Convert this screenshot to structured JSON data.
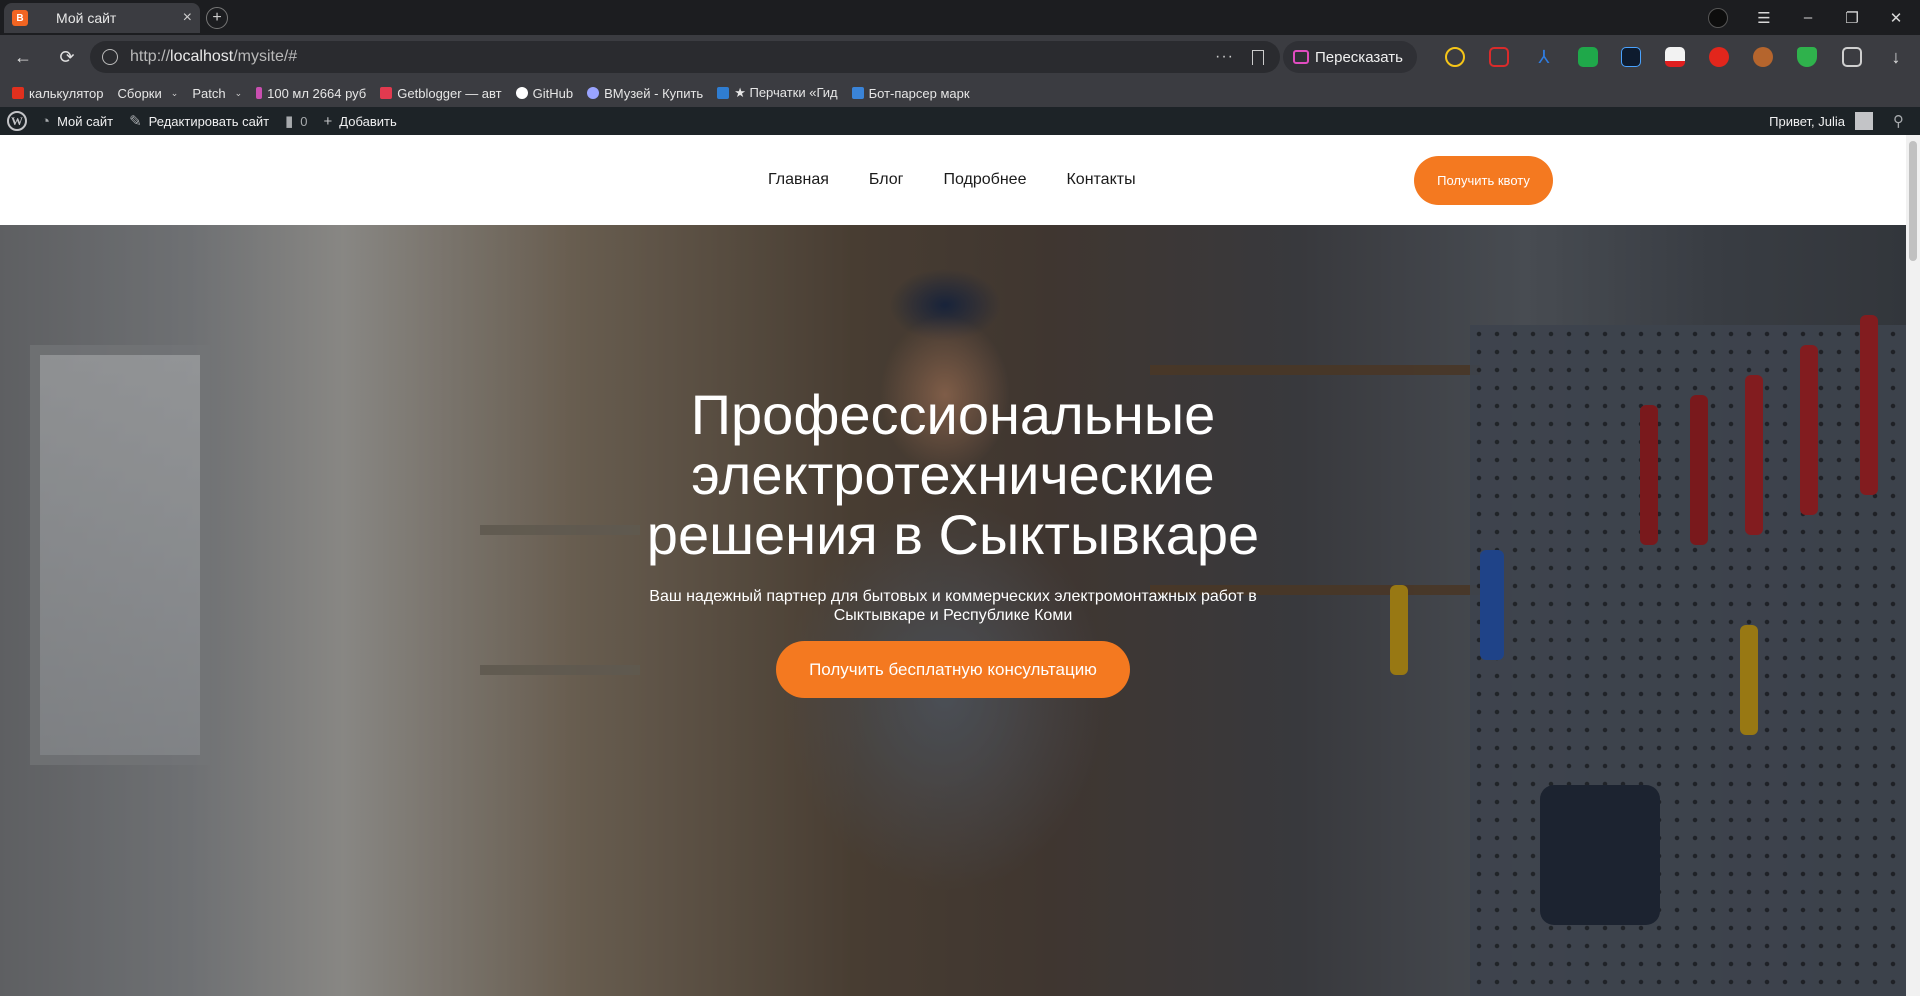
{
  "browser": {
    "tab_title": "Мой сайт",
    "tab_favicon_letter": "B",
    "new_tab": "+",
    "close_tab": "×",
    "url_scheme": "http://",
    "url_host": "localhost",
    "url_path": "/mysite/#",
    "url_menu": "···",
    "retell_label": "Пересказать",
    "window_controls": {
      "menu": "☰",
      "minimize": "–",
      "restore": "❐",
      "close": "✕"
    },
    "bookmarks": [
      {
        "label": "калькулятор",
        "icon": "yandex-icon",
        "color": "#e0301e"
      },
      {
        "label": "Сборки",
        "icon": "folder-icon",
        "color": "",
        "dropdown": true
      },
      {
        "label": "Patch",
        "icon": "folder-icon",
        "color": "",
        "dropdown": true
      },
      {
        "label": "100 мл 2664 руб",
        "icon": "dropper-icon",
        "color": "#c94fb0"
      },
      {
        "label": "Getblogger — авт",
        "icon": "getblogger-icon",
        "color": "#e23a4f"
      },
      {
        "label": "GitHub",
        "icon": "github-icon",
        "color": "#ffffff"
      },
      {
        "label": "ВМузей - Купить",
        "icon": "vmuseum-icon",
        "color": "#9aa4ff"
      },
      {
        "label": "★ Перчатки «Гид",
        "icon": "site-icon",
        "color": "#2f7dd1"
      },
      {
        "label": "Бот-парсер марк",
        "icon": "bot-icon",
        "color": "#3a84d8"
      }
    ]
  },
  "adminbar": {
    "site_name": "Мой сайт",
    "edit_site": "Редактировать сайт",
    "comments_count": "0",
    "add_new": "Добавить",
    "greeting": "Привет, Julia"
  },
  "site": {
    "menu": [
      "Главная",
      "Блог",
      "Подробнее",
      "Контакты"
    ],
    "header_cta": "Получить квоту",
    "hero": {
      "title_line1": "Профессиональные",
      "title_line2": "электротехнические",
      "title_line3": "решения в Сыктывкаре",
      "subtitle_line1": "Ваш надежный партнер для бытовых и коммерческих электромонтажных работ в",
      "subtitle_line2": "Сыктывкаре и Республике Коми",
      "cta": "Получить бесплатную консультацию"
    }
  },
  "colors": {
    "accent": "#f47920",
    "adminbar": "#1d2327",
    "chrome": "#3b3c41"
  }
}
